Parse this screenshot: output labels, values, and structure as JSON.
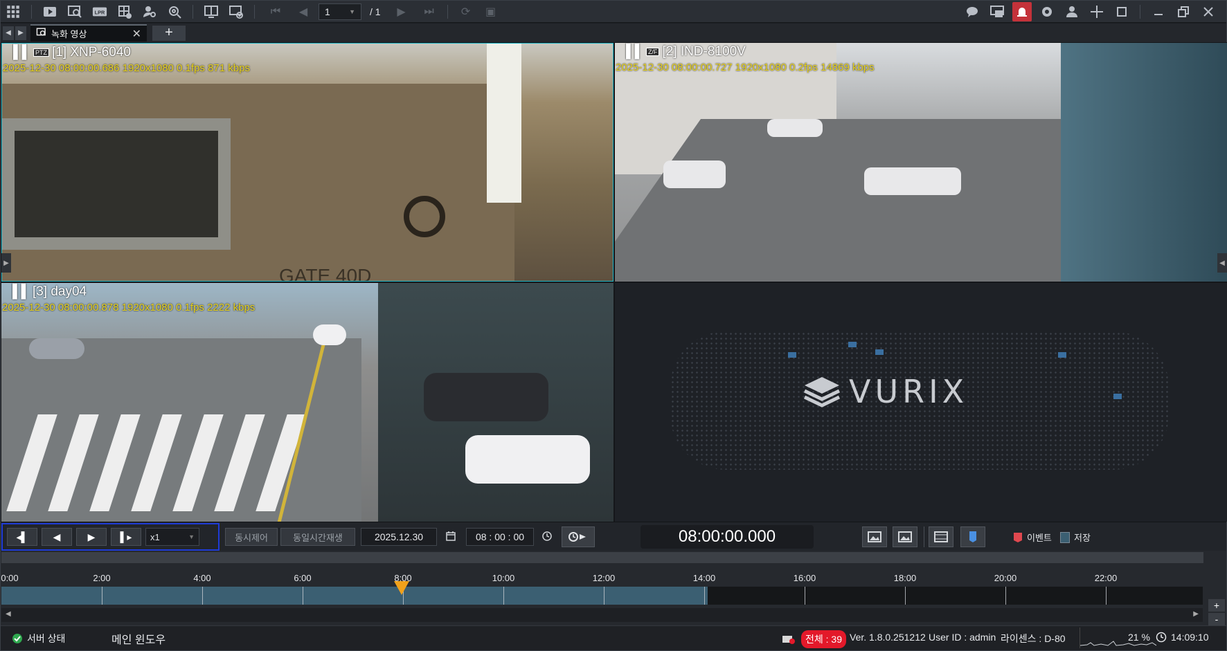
{
  "toolbar": {
    "left_icons": [
      "grid-menu-icon",
      "playback-icon",
      "video-search-icon",
      "lpr-icon",
      "layout-icon",
      "person-search-icon",
      "settings-search-icon"
    ],
    "lpr_label": "LPR",
    "page_current": "1",
    "page_total": "/ 1",
    "right_icons": [
      "chat-icon",
      "monitor-icon",
      "alarm-icon",
      "gear-icon",
      "user-icon",
      "move-icon",
      "fullscreen-icon",
      "minimize-icon",
      "restore-icon",
      "close-icon"
    ]
  },
  "tabs": {
    "items": [
      {
        "label": "녹화 영상"
      }
    ],
    "add_label": "+"
  },
  "cameras": [
    {
      "title": "[1] XNP-6040",
      "tag": "PTZ",
      "info": "2025-12-30 08:00:00.686 1920x1080  0.1fps 871 kbps"
    },
    {
      "title": "[2] IND-8100V",
      "tag": "Z/F",
      "info": "2025-12-30 08:00:00.727 1920x1080  0.2fps 14869 kbps"
    },
    {
      "title": "[3] day04",
      "tag": "",
      "info": "2025-12-30 08:00:00.878 1920x1080  0.1fps 2222 kbps"
    }
  ],
  "empty_tile": {
    "logo_text": "VURIX"
  },
  "controls": {
    "speed": "x1",
    "sync_control": "동시제어",
    "sync_playback": "동일시간재생",
    "date": "2025.12.30",
    "time": "08 : 00 : 00",
    "current_time": "08:00:00.000",
    "legend_event": "이벤트",
    "legend_storage": "저장",
    "colors": {
      "event": "#e0484f",
      "storage": "#3b5f72",
      "accent": "#1e3bd6"
    }
  },
  "timeline": {
    "labels": [
      "0:00",
      "2:00",
      "4:00",
      "6:00",
      "8:00",
      "10:00",
      "12:00",
      "14:00",
      "16:00",
      "18:00",
      "20:00",
      "22:00"
    ],
    "cursor": "8:00"
  },
  "statusbar": {
    "server_status": "서버 상태",
    "main_window": "메인 윈도우",
    "total_label": "전체 : 39",
    "version": "Ver. 1.8.0.251212",
    "user_id": "User ID : admin",
    "license": "라이센스 : D-80",
    "cpu": "21 %",
    "clock": "14:09:10"
  }
}
